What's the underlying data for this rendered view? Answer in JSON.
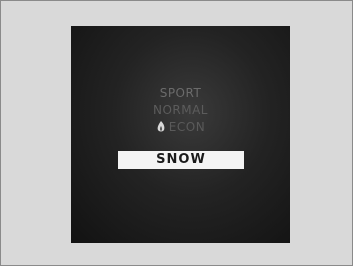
{
  "display": {
    "modes": {
      "sport": "SPORT",
      "normal": "NORMAL",
      "econ": "ECON",
      "snow": "SNOW"
    },
    "selected_mode": "SNOW",
    "econ_icon": "leaf-flame-icon"
  }
}
